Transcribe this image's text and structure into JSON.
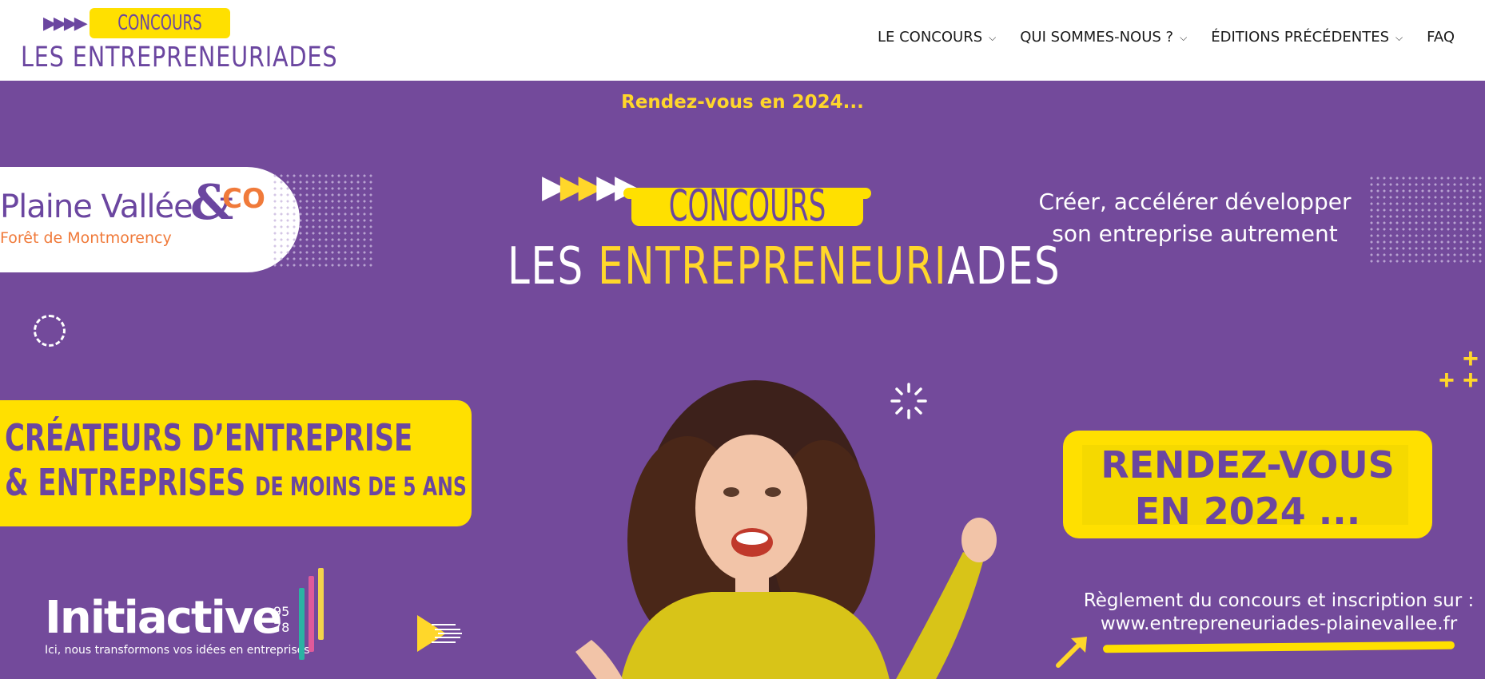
{
  "header": {
    "logo": {
      "concours": "CONCOURS",
      "name": "LES ENTREPRENEURIADES",
      "arrows": "▶▶▶▶"
    },
    "nav": [
      {
        "label": "LE CONCOURS",
        "has_dropdown": true
      },
      {
        "label": "QUI SOMMES-NOUS ?",
        "has_dropdown": true
      },
      {
        "label": "ÉDITIONS PRÉCÉDENTES",
        "has_dropdown": true
      },
      {
        "label": "FAQ",
        "has_dropdown": false
      }
    ],
    "dropdown_icon": "chevron-down-icon"
  },
  "hero": {
    "announcement": "Rendez-vous en 2024...",
    "partner_plaine": {
      "title": "Plaine Vallée",
      "amp": "&",
      "co": "CO",
      "subtitle": "Forêt de Montmorency"
    },
    "main_logo": {
      "concours": "CONCOURS",
      "name_white_1": "LES ",
      "name_yellow": "ENTREPRENEURI",
      "name_white_2": "ADES"
    },
    "tagline": {
      "line1": "Créer, accélérer    développer",
      "line2": "son entreprise autrement"
    },
    "creators": {
      "line1": "CRÉATEURS D’ENTREPRISE",
      "line2_big": "& ENTREPRISES ",
      "line2_small": "DE MOINS DE 5 ANS"
    },
    "rdv": {
      "line1": "RENDEZ-VOUS",
      "line2": "EN 2024 ..."
    },
    "initiactive": {
      "name": "Initiactive",
      "num_top": "95",
      "num_bottom": "78",
      "tagline": "Ici, nous transformons vos idées en entreprises"
    },
    "registration": {
      "line1": "Règlement du concours et inscription sur :",
      "line2": "www.entrepreneuriades-plainevallee.fr"
    },
    "colors": {
      "purple_bg": "#734a9b",
      "yellow": "#ffe000",
      "orange": "#f07a3a"
    }
  }
}
